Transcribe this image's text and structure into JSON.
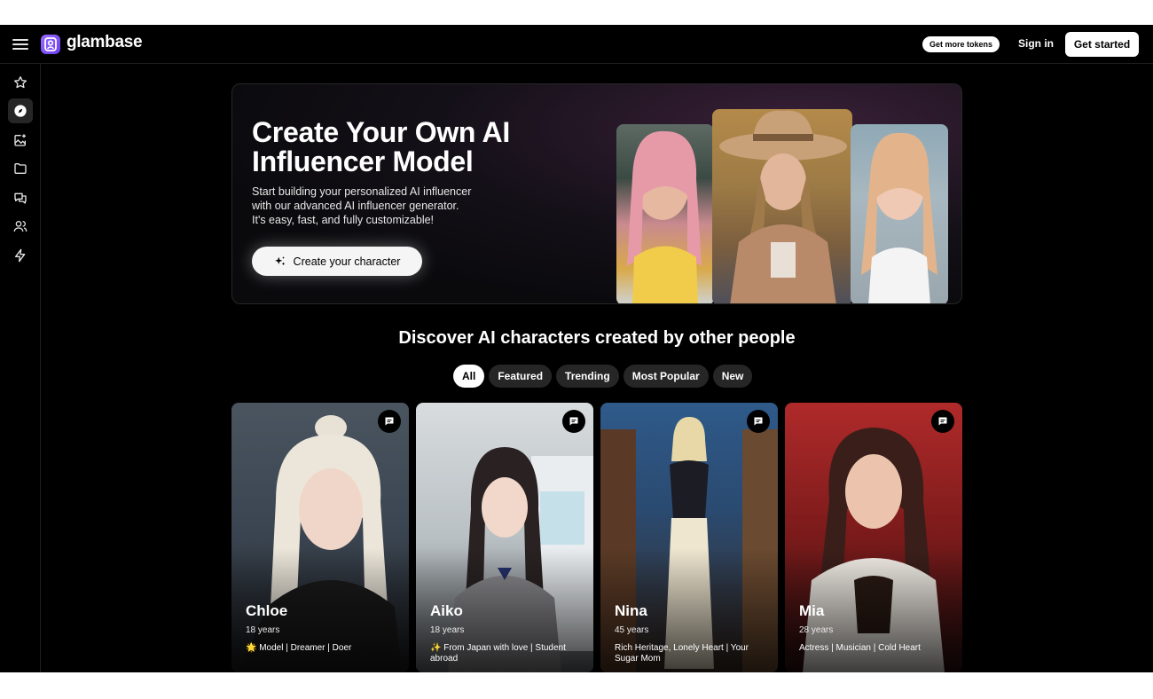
{
  "header": {
    "logo_text": "glambase",
    "tokens_label": "Get more tokens",
    "signin_label": "Sign in",
    "get_started_label": "Get started"
  },
  "sidebar": {
    "items": [
      {
        "icon": "star-icon"
      },
      {
        "icon": "compass-icon",
        "active": true
      },
      {
        "icon": "image-plus-icon"
      },
      {
        "icon": "folder-icon"
      },
      {
        "icon": "chat-icon"
      },
      {
        "icon": "users-icon"
      },
      {
        "icon": "lightning-icon"
      }
    ]
  },
  "hero": {
    "title_line1": "Create Your Own AI",
    "title_line2": "Influencer Model",
    "subtitle_line1": "Start building your personalized AI influencer",
    "subtitle_line2": "with our advanced AI influencer generator.",
    "subtitle_line3": "It's easy, fast, and fully customizable!",
    "cta_label": "Create your character"
  },
  "discover": {
    "title": "Discover AI characters created by other people",
    "filters": [
      "All",
      "Featured",
      "Trending",
      "Most Popular",
      "New"
    ],
    "active_filter": "All"
  },
  "characters": [
    {
      "name": "Chloe",
      "age": "18 years",
      "desc": "🌟 Model | Dreamer | Doer"
    },
    {
      "name": "Aiko",
      "age": "18 years",
      "desc": "✨ From Japan with love | Student abroad"
    },
    {
      "name": "Nina",
      "age": "45 years",
      "desc": "Rich Heritage, Lonely Heart | Your Sugar Mom"
    },
    {
      "name": "Mia",
      "age": "28 years",
      "desc": "Actress | Musician | Cold Heart"
    }
  ],
  "colors": {
    "background": "#000000",
    "logo_accent": "#7c4dff",
    "chip": "#262626"
  }
}
